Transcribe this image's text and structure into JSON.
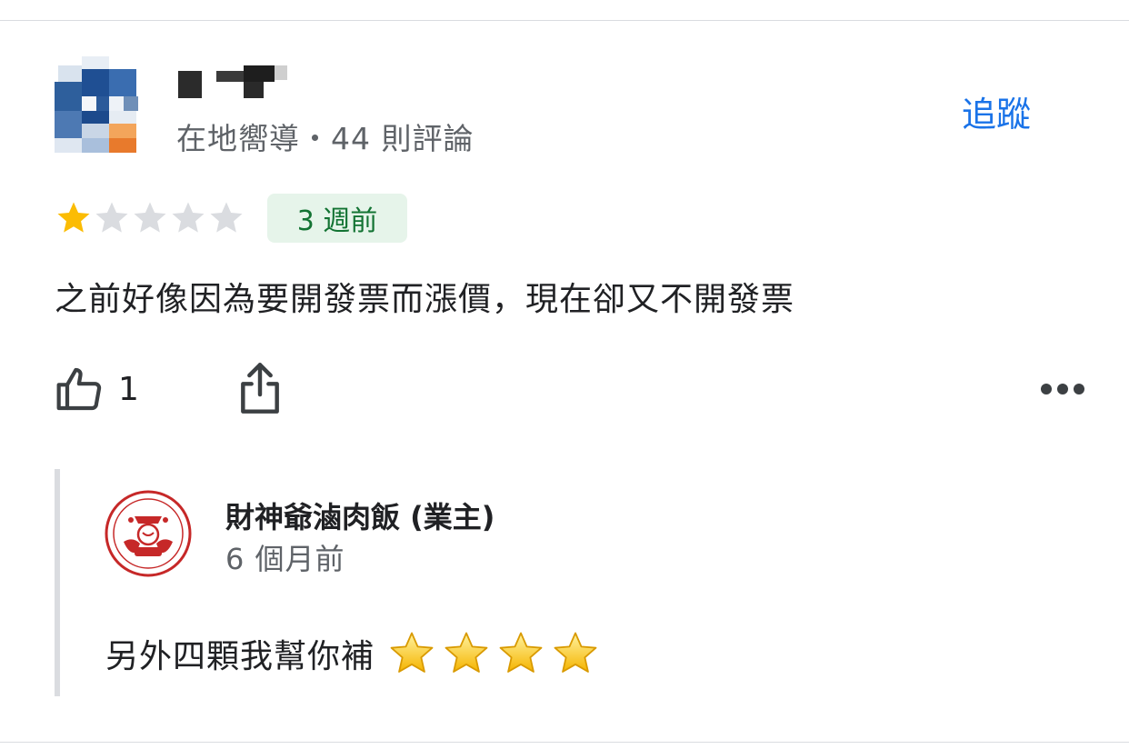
{
  "reviewer": {
    "meta": "在地嚮導・44 則評論",
    "follow_label": "追蹤"
  },
  "review": {
    "rating": 1,
    "max_rating": 5,
    "time_ago": "3 週前",
    "text": "之前好像因為要開發票而漲價，現在卻又不開發票",
    "like_count": "1"
  },
  "owner_reply": {
    "name": "財神爺滷肉飯 (業主)",
    "time_ago": "6 個月前",
    "text": "另外四顆我幫你補",
    "emoji_star_count": 4
  },
  "colors": {
    "accent": "#1a73e8",
    "star_filled": "#fbbc04",
    "star_empty": "#dadce0",
    "badge_bg": "#e6f4ea",
    "badge_text": "#137333",
    "logo_red": "#c62828"
  }
}
